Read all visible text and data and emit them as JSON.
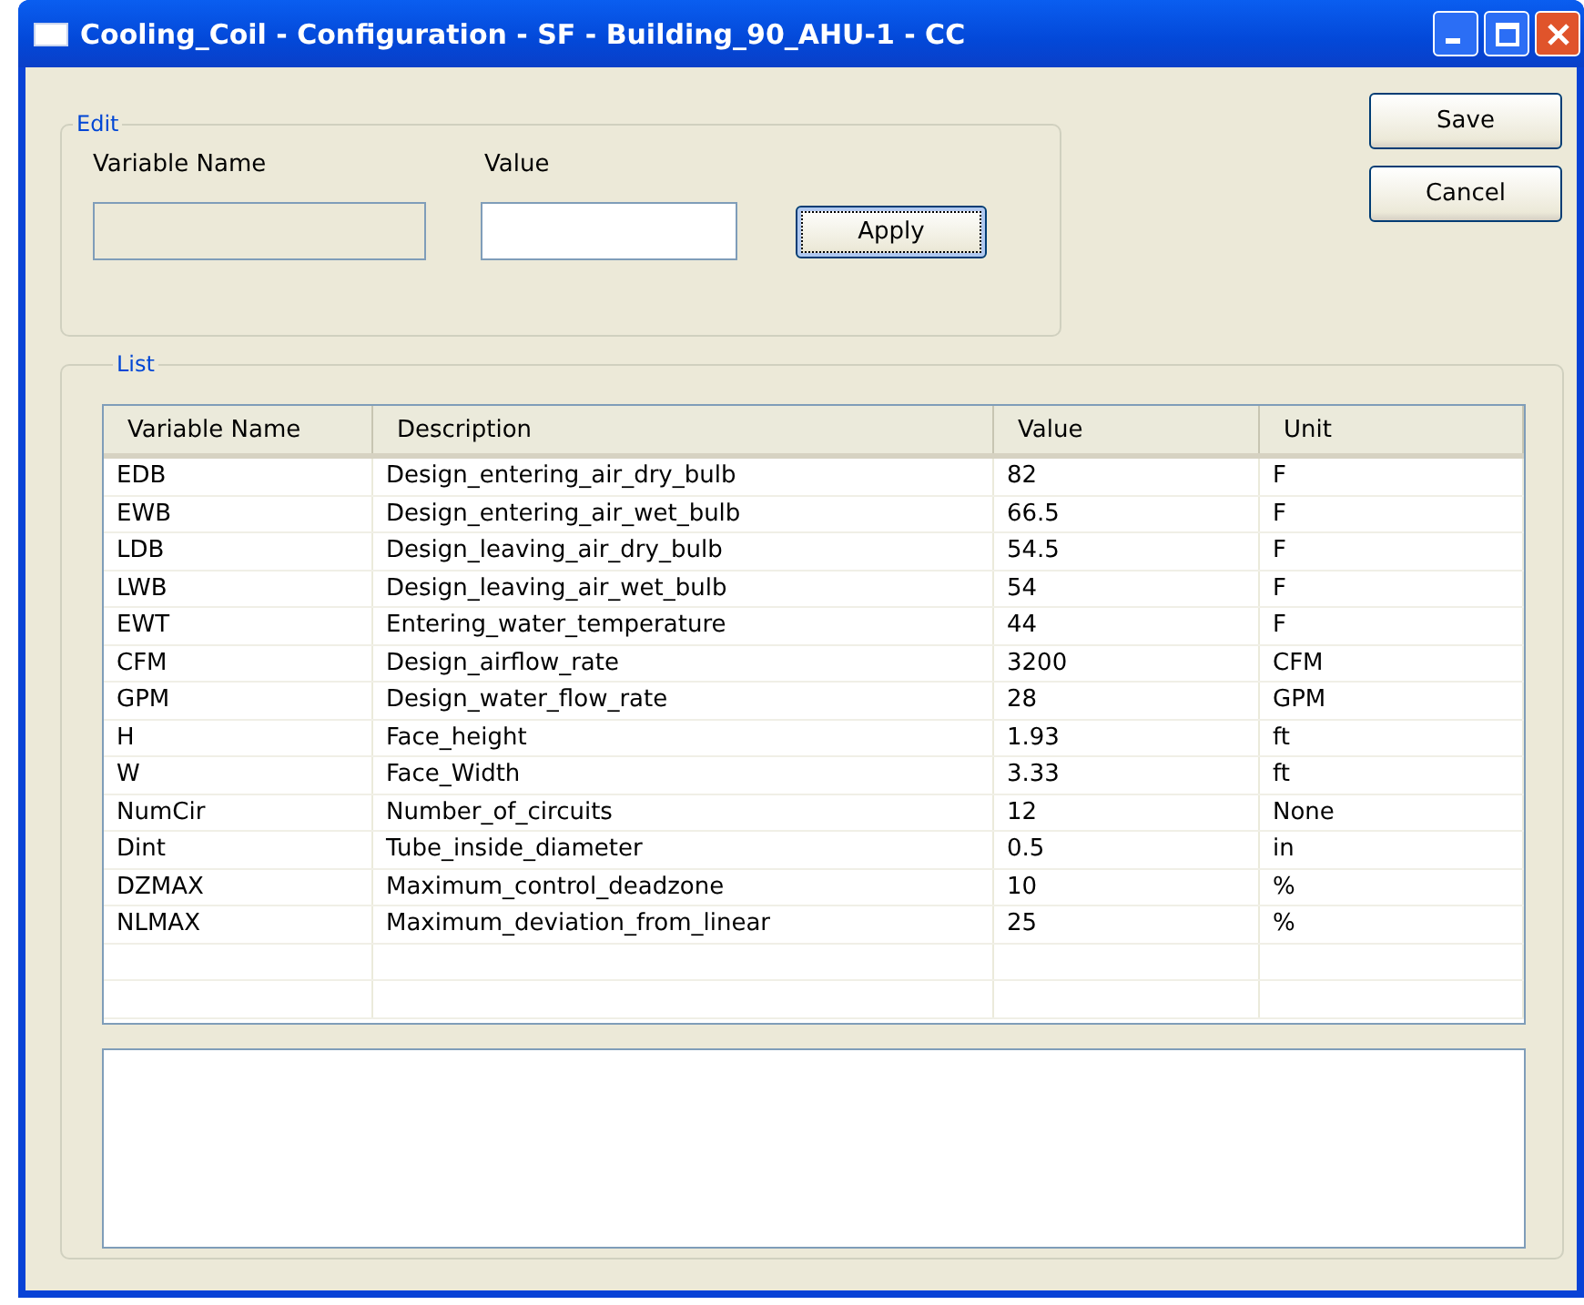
{
  "window": {
    "title": "Cooling_Coil - Configuration - SF - Building_90_AHU-1 - CC"
  },
  "edit": {
    "legend": "Edit",
    "name_label": "Variable Name",
    "value_label": "Value",
    "name_disabled": true,
    "apply": "Apply"
  },
  "buttons": [
    "Save",
    "Cancel"
  ],
  "list": {
    "legend": "List",
    "columns": [
      "Variable Name",
      "Description",
      "Value",
      "Unit"
    ],
    "rows": [
      [
        "EDB",
        "Design_entering_air_dry_bulb",
        "82",
        "F"
      ],
      [
        "EWB",
        "Design_entering_air_wet_bulb",
        "66.5",
        "F"
      ],
      [
        "LDB",
        "Design_leaving_air_dry_bulb",
        "54.5",
        "F"
      ],
      [
        "LWB",
        "Design_leaving_air_wet_bulb",
        "54",
        "F"
      ],
      [
        "EWT",
        "Entering_water_temperature",
        "44",
        "F"
      ],
      [
        "CFM",
        "Design_airflow_rate",
        "3200",
        "CFM"
      ],
      [
        "GPM",
        "Design_water_flow_rate",
        "28",
        "GPM"
      ],
      [
        "H",
        "Face_height",
        "1.93",
        "ft"
      ],
      [
        "W",
        "Face_Width",
        "3.33",
        "ft"
      ],
      [
        "NumCir",
        "Number_of_circuits",
        "12",
        "None"
      ],
      [
        "Dint",
        "Tube_inside_diameter",
        "0.5",
        "in"
      ],
      [
        "DZMAX",
        "Maximum_control_deadzone",
        "10",
        "%"
      ],
      [
        "NLMAX",
        "Maximum_deviation_from_linear",
        "25",
        "%"
      ]
    ]
  }
}
